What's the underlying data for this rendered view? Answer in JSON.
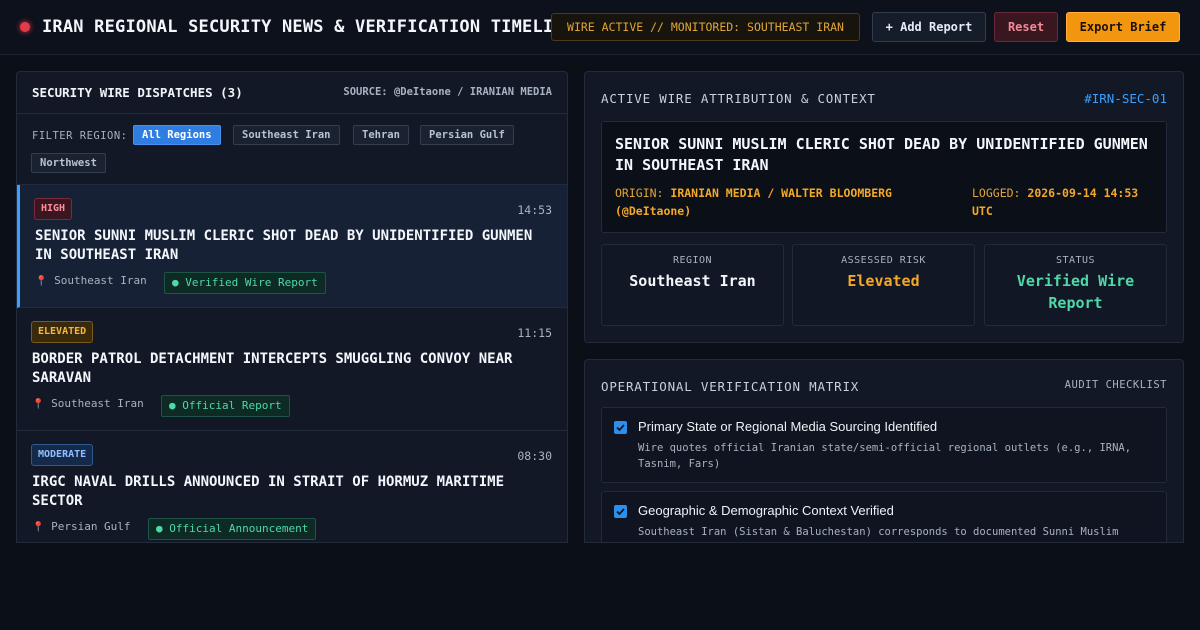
{
  "header": {
    "title": "IRAN REGIONAL SECURITY NEWS & VERIFICATION TIMELINE",
    "wire_status": "WIRE ACTIVE // MONITORED: SOUTHEAST IRAN",
    "add_report": "+ Add Report",
    "reset": "Reset",
    "export": "Export Brief"
  },
  "dispatches": {
    "title": "SECURITY WIRE DISPATCHES (3)",
    "source": "SOURCE: @DeItaone / IRANIAN MEDIA",
    "filter_label": "FILTER REGION:",
    "filters": [
      "All Regions",
      "Southeast Iran",
      "Tehran",
      "Persian Gulf",
      "Northwest"
    ],
    "active_filter": "All Regions",
    "items": [
      {
        "severity": "HIGH",
        "time": "14:53",
        "title": "SENIOR SUNNI MUSLIM CLERIC SHOT DEAD BY UNIDENTIFIED GUNMEN IN SOUTHEAST IRAN",
        "location": "Southeast Iran",
        "status": "● Verified Wire Report"
      },
      {
        "severity": "ELEVATED",
        "time": "11:15",
        "title": "BORDER PATROL DETACHMENT INTERCEPTS SMUGGLING CONVOY NEAR SARAVAN",
        "location": "Southeast Iran",
        "status": "● Official Report"
      },
      {
        "severity": "MODERATE",
        "time": "08:30",
        "title": "IRGC NAVAL DRILLS ANNOUNCED IN STRAIT OF HORMUZ MARITIME SECTOR",
        "location": "Persian Gulf",
        "status": "● Official Announcement"
      }
    ]
  },
  "attribution": {
    "title": "ACTIVE WIRE ATTRIBUTION & CONTEXT",
    "id": "#IRN-SEC-01",
    "headline": "SENIOR SUNNI MUSLIM CLERIC SHOT DEAD BY UNIDENTIFIED GUNMEN IN SOUTHEAST IRAN",
    "origin_label": "ORIGIN:",
    "origin_value": "IRANIAN MEDIA / WALTER BLOOMBERG (@DeItaone)",
    "logged_label": "LOGGED:",
    "logged_value": "2026-09-14 14:53 UTC",
    "stats": [
      {
        "label": "REGION",
        "value": "Southeast Iran",
        "color": "#f3f6fb"
      },
      {
        "label": "ASSESSED RISK",
        "value": "Elevated",
        "color": "#f4a828"
      },
      {
        "label": "STATUS",
        "value": "Verified Wire Report",
        "color": "#4ed8a8"
      }
    ]
  },
  "matrix": {
    "title": "OPERATIONAL VERIFICATION MATRIX",
    "audit": "AUDIT CHECKLIST",
    "items": [
      {
        "checked": true,
        "title": "Primary State or Regional Media Sourcing Identified",
        "desc": "Wire quotes official Iranian state/semi-official regional outlets (e.g., IRNA, Tasnim, Fars)"
      },
      {
        "checked": true,
        "title": "Geographic & Demographic Context Verified",
        "desc": "Southeast Iran (Sistan & Baluchestan) corresponds to documented Sunni Muslim demographic"
      }
    ]
  },
  "colors": {
    "accent": "#3aa0ff",
    "warning": "#f4a828",
    "danger": "#e53a4a",
    "success": "#4ed8a8"
  }
}
